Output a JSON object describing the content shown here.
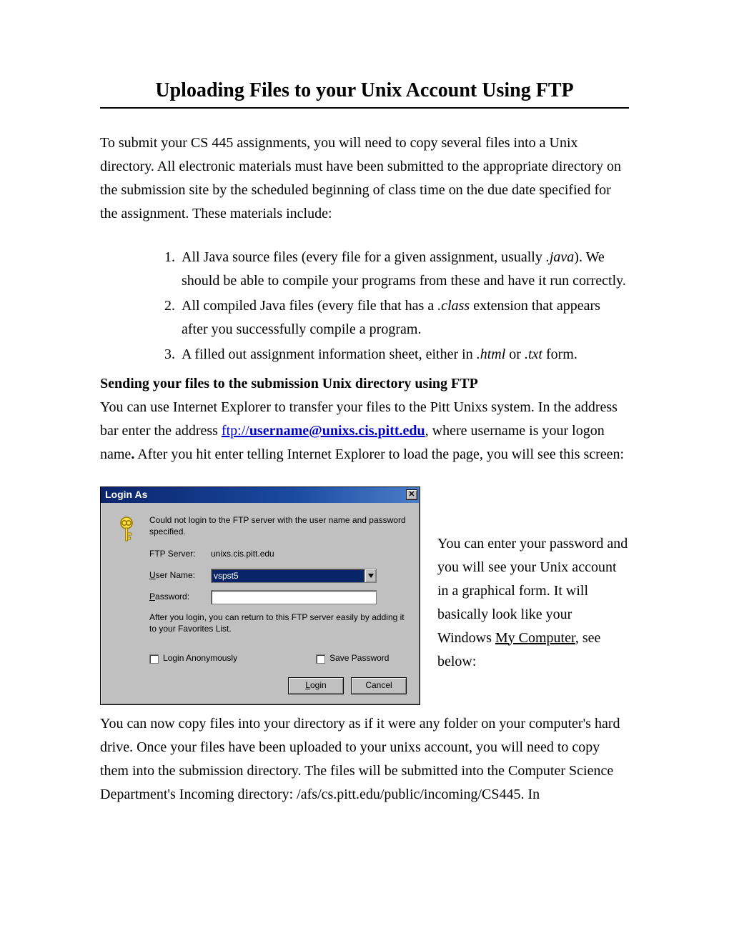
{
  "title": "Uploading Files to your Unix Account Using FTP",
  "intro": "To submit your CS 445 assignments, you will need to copy several files into a Unix directory.  All electronic materials must have been submitted to the appropriate directory on the submission site by the scheduled beginning of class time on the due date specified for the assignment.  These materials include:",
  "list": {
    "i1a": "All Java source files (every file for a given assignment, usually ",
    "i1_ext": ".java",
    "i1b": ").  We should be able to compile your programs from these and have it run correctly.",
    "i2a": "All compiled Java files (every file that has a ",
    "i2_ext": ".class",
    "i2b": " extension that appears after you successfully compile a program.",
    "i3a": "A filled out assignment information sheet, either in ",
    "i3_ext1": ".html",
    "i3_mid": " or ",
    "i3_ext2": ".txt",
    "i3b": " form."
  },
  "section_heading": "Sending your files to the submission Unix directory using FTP",
  "p2a": "You can use Internet Explorer to transfer your files to the Pitt Unixs system.  In the address bar enter the address ",
  "link_proto": "ftp://",
  "link_rest": "username@unixs.cis.pitt.edu",
  "p2b": ", where username is your logon name",
  "p2c": "  After you hit enter telling Internet Explorer to load the page, you will see this screen:",
  "caption_a": "You can enter your password and you will see your Unix account in a graphical form.  It will basically look like your Windows ",
  "caption_mc": "My Computer",
  "caption_b": ", see below:",
  "after": "You can now copy files into your directory as if it were any folder on your computer's hard drive.  Once your files have been uploaded to your unixs account, you will need to copy them into the submission directory.  The files will be submitted into the Computer Science Department's Incoming directory: /afs/cs.pitt.edu/public/incoming/CS445.  In",
  "dialog": {
    "title": "Login As",
    "close_glyph": "✕",
    "msg": "Could not login to the FTP server with the user name and password specified.",
    "lbl_server": "FTP Server:",
    "val_server": "unixs.cis.pitt.edu",
    "lbl_user_u": "U",
    "lbl_user_rest": "ser Name:",
    "val_user": "vspst5",
    "lbl_pass_u": "P",
    "lbl_pass_rest": "assword:",
    "val_pass": "",
    "note": "After you login, you can return to this FTP server easily by adding it to your Favorites List.",
    "chk1_pre": "Login ",
    "chk1_u": "A",
    "chk1_post": "nonymously",
    "chk2_u": "S",
    "chk2_post": "ave Password",
    "btn_login_u": "L",
    "btn_login_rest": "ogin",
    "btn_cancel": "Cancel"
  }
}
